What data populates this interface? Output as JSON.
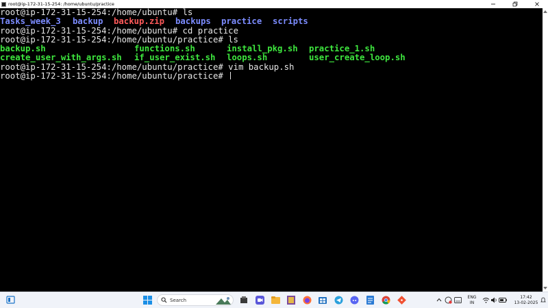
{
  "window": {
    "title": "root@ip-172-31-15-254: /home/ubuntu/practice"
  },
  "terminal": {
    "prompt_home": "root@ip-172-31-15-254:/home/ubuntu# ",
    "prompt_practice": "root@ip-172-31-15-254:/home/ubuntu/practice# ",
    "commands": [
      "ls",
      "cd practice",
      "ls",
      "vim backup.sh"
    ],
    "ls_home": [
      {
        "name": "Tasks_week_3",
        "type": "dir"
      },
      {
        "name": "backup",
        "type": "dir"
      },
      {
        "name": "backup.zip",
        "type": "archive"
      },
      {
        "name": "backups",
        "type": "dir"
      },
      {
        "name": "practice",
        "type": "dir"
      },
      {
        "name": "scripts",
        "type": "dir"
      }
    ],
    "ls_practice": [
      {
        "name": "backup.sh",
        "type": "exec"
      },
      {
        "name": "functions.sh",
        "type": "exec"
      },
      {
        "name": "install_pkg.sh",
        "type": "exec"
      },
      {
        "name": "practice_1.sh",
        "type": "exec"
      },
      {
        "name": "create_user_with_args.sh",
        "type": "exec"
      },
      {
        "name": "if_user_exist.sh",
        "type": "exec"
      },
      {
        "name": "loops.sh",
        "type": "exec"
      },
      {
        "name": "user_create_loop.sh",
        "type": "exec"
      }
    ]
  },
  "colors": {
    "terminal_bg": "#000000",
    "terminal_text": "#e6e6e6",
    "directory": "#7c8cff",
    "archive": "#ff5a5a",
    "executable": "#3ee63e",
    "taskbar_bg": "#f0f3f9"
  },
  "taskbar": {
    "search_placeholder": "Search",
    "pinned_icons": [
      "windows-start-icon",
      "search-icon",
      "file-explorer-icon",
      "zoom-icon",
      "folder-icon",
      "archive-app-icon",
      "firefox-icon",
      "store-icon",
      "telegram-icon",
      "discord-icon",
      "notepad-icon",
      "chrome-icon",
      "git-icon"
    ],
    "lang_primary": "ENG",
    "lang_secondary": "IN",
    "time": "17:42",
    "date": "13-02-2025"
  }
}
